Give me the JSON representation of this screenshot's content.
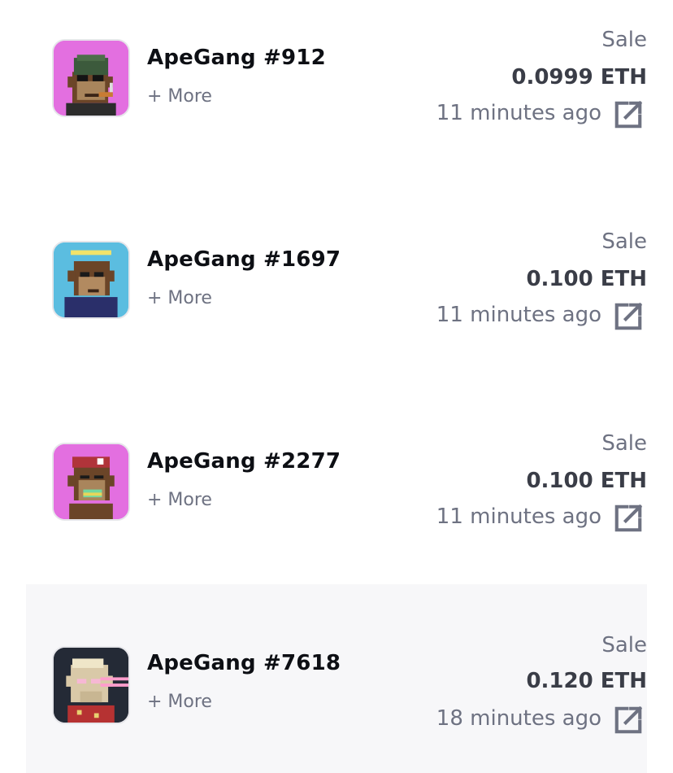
{
  "accent": "#6e7282",
  "items": [
    {
      "name": "ApeGang #912",
      "more": "+ More",
      "kind": "Sale",
      "price": "0.0999 ETH",
      "time": "11 minutes ago",
      "bg": "#e36fe0",
      "icon": "external-link-icon"
    },
    {
      "name": "ApeGang #1697",
      "more": "+ More",
      "kind": "Sale",
      "price": "0.100 ETH",
      "time": "11 minutes ago",
      "bg": "#5bbde0",
      "icon": "external-link-icon"
    },
    {
      "name": "ApeGang #2277",
      "more": "+ More",
      "kind": "Sale",
      "price": "0.100 ETH",
      "time": "11 minutes ago",
      "bg": "#e36fe0",
      "icon": "external-link-icon"
    },
    {
      "name": "ApeGang #7618",
      "more": "+ More",
      "kind": "Sale",
      "price": "0.120 ETH",
      "time": "18 minutes ago",
      "bg": "#242a36",
      "icon": "external-link-icon"
    }
  ]
}
